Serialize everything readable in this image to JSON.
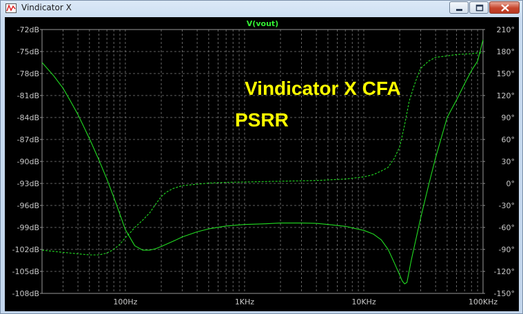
{
  "window": {
    "title": "Vindicator X",
    "buttons": [
      "minimize",
      "maximize",
      "close"
    ]
  },
  "colors": {
    "background": "#000000",
    "trace": "#22dd22",
    "grid": "#808080",
    "axis_text": "#c8c8c8",
    "annotation": "#ffff00"
  },
  "chart_data": {
    "type": "line",
    "title": "V(vout)",
    "x_scale": "log",
    "xlim": [
      20,
      100000
    ],
    "x_ticks": [
      {
        "value": 100,
        "label": "100Hz"
      },
      {
        "value": 1000,
        "label": "1KHz"
      },
      {
        "value": 10000,
        "label": "10KHz"
      },
      {
        "value": 100000,
        "label": "100KHz"
      }
    ],
    "y_left": {
      "unit": "dB",
      "range": [
        -108,
        -72
      ],
      "ticks": [
        "-72dB",
        "-75dB",
        "-78dB",
        "-81dB",
        "-84dB",
        "-87dB",
        "-90dB",
        "-93dB",
        "-96dB",
        "-99dB",
        "-102dB",
        "-105dB",
        "-108dB"
      ]
    },
    "y_right": {
      "unit": "degrees",
      "range": [
        -150,
        210
      ],
      "ticks": [
        "210°",
        "180°",
        "150°",
        "120°",
        "90°",
        "60°",
        "30°",
        "0°",
        "-30°",
        "-60°",
        "-90°",
        "-120°",
        "-150°"
      ]
    },
    "grid": true,
    "annotations": [
      "Vindicator X CFA",
      "PSRR"
    ],
    "series": [
      {
        "axis": "left",
        "style": "solid",
        "points": [
          [
            20,
            -76.5
          ],
          [
            25,
            -78.3
          ],
          [
            30,
            -80.0
          ],
          [
            35,
            -81.9
          ],
          [
            40,
            -83.6
          ],
          [
            50,
            -86.9
          ],
          [
            60,
            -89.8
          ],
          [
            70,
            -92.4
          ],
          [
            80,
            -94.9
          ],
          [
            90,
            -97.2
          ],
          [
            100,
            -99.3
          ],
          [
            120,
            -101.5
          ],
          [
            140,
            -102.1
          ],
          [
            160,
            -102.1
          ],
          [
            180,
            -101.9
          ],
          [
            200,
            -101.6
          ],
          [
            250,
            -100.9
          ],
          [
            300,
            -100.3
          ],
          [
            400,
            -99.6
          ],
          [
            500,
            -99.2
          ],
          [
            700,
            -98.8
          ],
          [
            1000,
            -98.6
          ],
          [
            1500,
            -98.5
          ],
          [
            2000,
            -98.4
          ],
          [
            3000,
            -98.4
          ],
          [
            4000,
            -98.45
          ],
          [
            5000,
            -98.6
          ],
          [
            7000,
            -98.85
          ],
          [
            10000,
            -99.4
          ],
          [
            12000,
            -99.9
          ],
          [
            14000,
            -100.7
          ],
          [
            16000,
            -102.0
          ],
          [
            18000,
            -103.8
          ],
          [
            20000,
            -105.5
          ],
          [
            21000,
            -106.3
          ],
          [
            22000,
            -106.7
          ],
          [
            23000,
            -106.5
          ],
          [
            25000,
            -103.5
          ],
          [
            30000,
            -97.7
          ],
          [
            35000,
            -93.2
          ],
          [
            40000,
            -89.5
          ],
          [
            50000,
            -84.0
          ],
          [
            60000,
            -81.6
          ],
          [
            70000,
            -79.4
          ],
          [
            80000,
            -77.6
          ],
          [
            90000,
            -76.3
          ],
          [
            100000,
            -73.4
          ]
        ]
      },
      {
        "axis": "right",
        "style": "dashed",
        "points": [
          [
            20,
            -91
          ],
          [
            30,
            -94
          ],
          [
            40,
            -96
          ],
          [
            50,
            -97.5
          ],
          [
            60,
            -97.5
          ],
          [
            70,
            -95
          ],
          [
            80,
            -90
          ],
          [
            90,
            -83
          ],
          [
            100,
            -74
          ],
          [
            110,
            -67
          ],
          [
            120,
            -60
          ],
          [
            140,
            -50
          ],
          [
            160,
            -40
          ],
          [
            180,
            -28
          ],
          [
            200,
            -18
          ],
          [
            220,
            -12
          ],
          [
            250,
            -7
          ],
          [
            300,
            -3
          ],
          [
            400,
            -1
          ],
          [
            500,
            0.5
          ],
          [
            700,
            1.5
          ],
          [
            1000,
            2
          ],
          [
            2000,
            3
          ],
          [
            4000,
            4
          ],
          [
            7000,
            6
          ],
          [
            10000,
            9
          ],
          [
            12000,
            12
          ],
          [
            14000,
            17
          ],
          [
            16000,
            22
          ],
          [
            18000,
            34
          ],
          [
            20000,
            50
          ],
          [
            22000,
            80
          ],
          [
            24000,
            112
          ],
          [
            26000,
            130
          ],
          [
            28000,
            145
          ],
          [
            30000,
            157
          ],
          [
            35000,
            167
          ],
          [
            40000,
            172
          ],
          [
            50000,
            174
          ],
          [
            60000,
            176
          ],
          [
            70000,
            176.5
          ],
          [
            80000,
            177
          ],
          [
            90000,
            178
          ],
          [
            100000,
            178
          ]
        ]
      }
    ]
  }
}
